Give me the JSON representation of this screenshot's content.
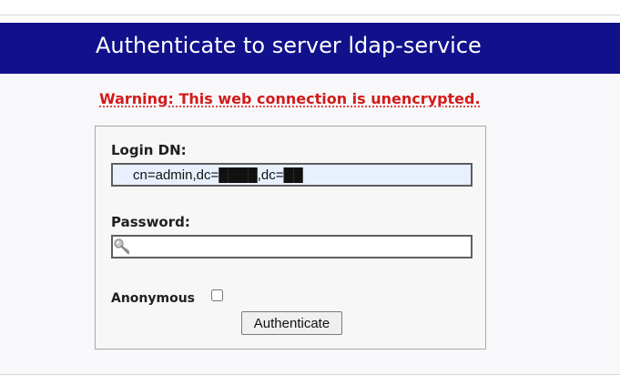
{
  "header": {
    "title": "Authenticate to server ldap-service"
  },
  "warning": {
    "text": "Warning: This web connection is unencrypted."
  },
  "login_form": {
    "login_dn_label": "Login DN:",
    "login_dn_value": "cn=admin,dc=████,dc=██",
    "password_label": "Password:",
    "password_value": "",
    "anonymous_label": "Anonymous",
    "anonymous_checked": false,
    "submit_label": "Authenticate",
    "password_field_icon": "key-icon"
  },
  "colors": {
    "header_bg": "#11118c",
    "header_text": "#ffffff",
    "warning_text": "#d21b1b",
    "dn_autofill_bg": "#e8f0fe"
  }
}
